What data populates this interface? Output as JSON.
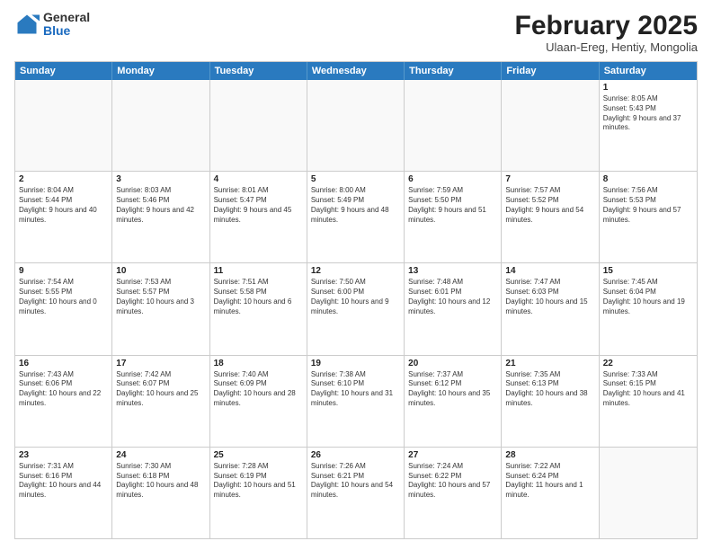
{
  "header": {
    "logo": {
      "general": "General",
      "blue": "Blue"
    },
    "title": "February 2025",
    "subtitle": "Ulaan-Ereg, Hentiy, Mongolia"
  },
  "calendar": {
    "weekdays": [
      "Sunday",
      "Monday",
      "Tuesday",
      "Wednesday",
      "Thursday",
      "Friday",
      "Saturday"
    ],
    "rows": [
      [
        {
          "day": "",
          "info": "",
          "empty": true
        },
        {
          "day": "",
          "info": "",
          "empty": true
        },
        {
          "day": "",
          "info": "",
          "empty": true
        },
        {
          "day": "",
          "info": "",
          "empty": true
        },
        {
          "day": "",
          "info": "",
          "empty": true
        },
        {
          "day": "",
          "info": "",
          "empty": true
        },
        {
          "day": "1",
          "info": "Sunrise: 8:05 AM\nSunset: 5:43 PM\nDaylight: 9 hours and 37 minutes.",
          "empty": false
        }
      ],
      [
        {
          "day": "2",
          "info": "Sunrise: 8:04 AM\nSunset: 5:44 PM\nDaylight: 9 hours and 40 minutes.",
          "empty": false
        },
        {
          "day": "3",
          "info": "Sunrise: 8:03 AM\nSunset: 5:46 PM\nDaylight: 9 hours and 42 minutes.",
          "empty": false
        },
        {
          "day": "4",
          "info": "Sunrise: 8:01 AM\nSunset: 5:47 PM\nDaylight: 9 hours and 45 minutes.",
          "empty": false
        },
        {
          "day": "5",
          "info": "Sunrise: 8:00 AM\nSunset: 5:49 PM\nDaylight: 9 hours and 48 minutes.",
          "empty": false
        },
        {
          "day": "6",
          "info": "Sunrise: 7:59 AM\nSunset: 5:50 PM\nDaylight: 9 hours and 51 minutes.",
          "empty": false
        },
        {
          "day": "7",
          "info": "Sunrise: 7:57 AM\nSunset: 5:52 PM\nDaylight: 9 hours and 54 minutes.",
          "empty": false
        },
        {
          "day": "8",
          "info": "Sunrise: 7:56 AM\nSunset: 5:53 PM\nDaylight: 9 hours and 57 minutes.",
          "empty": false
        }
      ],
      [
        {
          "day": "9",
          "info": "Sunrise: 7:54 AM\nSunset: 5:55 PM\nDaylight: 10 hours and 0 minutes.",
          "empty": false
        },
        {
          "day": "10",
          "info": "Sunrise: 7:53 AM\nSunset: 5:57 PM\nDaylight: 10 hours and 3 minutes.",
          "empty": false
        },
        {
          "day": "11",
          "info": "Sunrise: 7:51 AM\nSunset: 5:58 PM\nDaylight: 10 hours and 6 minutes.",
          "empty": false
        },
        {
          "day": "12",
          "info": "Sunrise: 7:50 AM\nSunset: 6:00 PM\nDaylight: 10 hours and 9 minutes.",
          "empty": false
        },
        {
          "day": "13",
          "info": "Sunrise: 7:48 AM\nSunset: 6:01 PM\nDaylight: 10 hours and 12 minutes.",
          "empty": false
        },
        {
          "day": "14",
          "info": "Sunrise: 7:47 AM\nSunset: 6:03 PM\nDaylight: 10 hours and 15 minutes.",
          "empty": false
        },
        {
          "day": "15",
          "info": "Sunrise: 7:45 AM\nSunset: 6:04 PM\nDaylight: 10 hours and 19 minutes.",
          "empty": false
        }
      ],
      [
        {
          "day": "16",
          "info": "Sunrise: 7:43 AM\nSunset: 6:06 PM\nDaylight: 10 hours and 22 minutes.",
          "empty": false
        },
        {
          "day": "17",
          "info": "Sunrise: 7:42 AM\nSunset: 6:07 PM\nDaylight: 10 hours and 25 minutes.",
          "empty": false
        },
        {
          "day": "18",
          "info": "Sunrise: 7:40 AM\nSunset: 6:09 PM\nDaylight: 10 hours and 28 minutes.",
          "empty": false
        },
        {
          "day": "19",
          "info": "Sunrise: 7:38 AM\nSunset: 6:10 PM\nDaylight: 10 hours and 31 minutes.",
          "empty": false
        },
        {
          "day": "20",
          "info": "Sunrise: 7:37 AM\nSunset: 6:12 PM\nDaylight: 10 hours and 35 minutes.",
          "empty": false
        },
        {
          "day": "21",
          "info": "Sunrise: 7:35 AM\nSunset: 6:13 PM\nDaylight: 10 hours and 38 minutes.",
          "empty": false
        },
        {
          "day": "22",
          "info": "Sunrise: 7:33 AM\nSunset: 6:15 PM\nDaylight: 10 hours and 41 minutes.",
          "empty": false
        }
      ],
      [
        {
          "day": "23",
          "info": "Sunrise: 7:31 AM\nSunset: 6:16 PM\nDaylight: 10 hours and 44 minutes.",
          "empty": false
        },
        {
          "day": "24",
          "info": "Sunrise: 7:30 AM\nSunset: 6:18 PM\nDaylight: 10 hours and 48 minutes.",
          "empty": false
        },
        {
          "day": "25",
          "info": "Sunrise: 7:28 AM\nSunset: 6:19 PM\nDaylight: 10 hours and 51 minutes.",
          "empty": false
        },
        {
          "day": "26",
          "info": "Sunrise: 7:26 AM\nSunset: 6:21 PM\nDaylight: 10 hours and 54 minutes.",
          "empty": false
        },
        {
          "day": "27",
          "info": "Sunrise: 7:24 AM\nSunset: 6:22 PM\nDaylight: 10 hours and 57 minutes.",
          "empty": false
        },
        {
          "day": "28",
          "info": "Sunrise: 7:22 AM\nSunset: 6:24 PM\nDaylight: 11 hours and 1 minute.",
          "empty": false
        },
        {
          "day": "",
          "info": "",
          "empty": true
        }
      ]
    ]
  }
}
